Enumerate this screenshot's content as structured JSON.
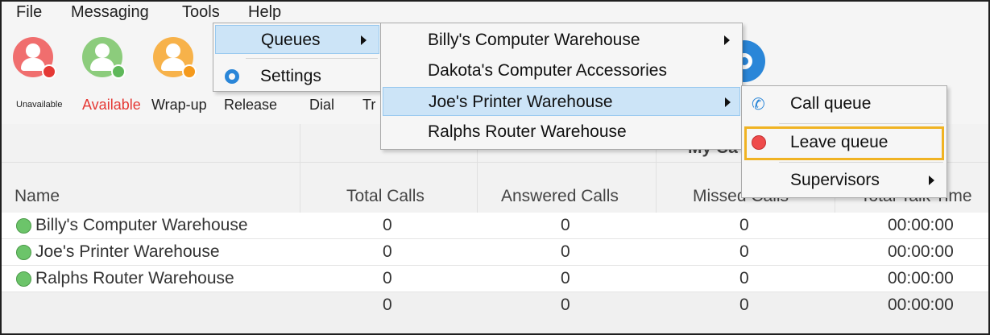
{
  "menubar": {
    "file": "File",
    "messaging": "Messaging",
    "tools": "Tools",
    "help": "Help"
  },
  "ribbon": {
    "unavailable": "Unavailable",
    "available": "Available",
    "wrapup": "Wrap-up",
    "release": "Release",
    "dial": "Dial",
    "transfer_partial": "Tr"
  },
  "colors": {
    "unavailable": "#f06e6e",
    "available": "#8ccc7c",
    "wrapup": "#f7b24a",
    "available_label": "#e53935",
    "highlight": "#cce4f7",
    "focus": "#f0b323"
  },
  "group_header_partial": "My Ca",
  "columns": [
    "Name",
    "Total Calls",
    "Answered Calls",
    "Missed Calls",
    "Total Talk Time"
  ],
  "rows": [
    {
      "name": "Billy's Computer Warehouse",
      "total": "0",
      "answered": "0",
      "missed": "0",
      "talk": "00:00:00"
    },
    {
      "name": "Joe's Printer Warehouse",
      "total": "0",
      "answered": "0",
      "missed": "0",
      "talk": "00:00:00"
    },
    {
      "name": "Ralphs Router Warehouse",
      "total": "0",
      "answered": "0",
      "missed": "0",
      "talk": "00:00:00"
    }
  ],
  "totals": {
    "total": "0",
    "answered": "0",
    "missed": "0",
    "talk": "00:00:00"
  },
  "tools_menu": {
    "queues": "Queues",
    "settings": "Settings"
  },
  "queues_menu": [
    "Billy's Computer Warehouse",
    "Dakota's Computer Accessories",
    "Joe's Printer Warehouse",
    "Ralphs Router Warehouse"
  ],
  "queue_actions": {
    "call_queue": "Call queue",
    "leave_queue": "Leave queue",
    "supervisors": "Supervisors"
  }
}
